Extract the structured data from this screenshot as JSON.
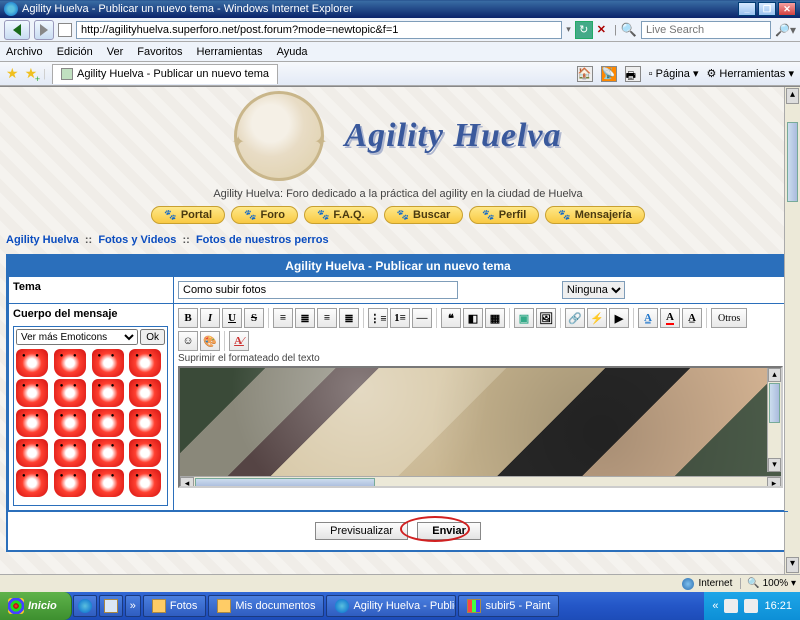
{
  "window": {
    "title": "Agility Huelva - Publicar un nuevo tema - Windows Internet Explorer"
  },
  "address_bar": {
    "url": "http://agilityhuelva.superforo.net/post.forum?mode=newtopic&f=1"
  },
  "search": {
    "placeholder": "Live Search"
  },
  "ie_menu": {
    "file": "Archivo",
    "edit": "Edición",
    "view": "Ver",
    "favorites": "Favoritos",
    "tools": "Herramientas",
    "help": "Ayuda"
  },
  "tab": {
    "label": "Agility Huelva - Publicar un nuevo tema"
  },
  "right_tools": {
    "page": "Página",
    "tools": "Herramientas"
  },
  "forum": {
    "title": "Agility Huelva",
    "subtitle": "Agility Huelva: Foro dedicado a la práctica del agility en la ciudad de Huelva",
    "nav": {
      "portal": "Portal",
      "foro": "Foro",
      "faq": "F.A.Q.",
      "buscar": "Buscar",
      "perfil": "Perfil",
      "mensajeria": "Mensajería"
    }
  },
  "breadcrumb": {
    "a": "Agility Huelva",
    "b": "Fotos y Videos",
    "c": "Fotos de nuestros perros",
    "sep": "::"
  },
  "post": {
    "header": "Agility Huelva - Publicar un nuevo tema",
    "subject_label": "Tema",
    "subject_value": "Como subir fotos",
    "subject_type": "Ninguna",
    "body_label": "Cuerpo del mensaje",
    "emoticons_select": "Ver más Emoticons",
    "emoticons_ok": "Ok",
    "toolbar": {
      "bold": "B",
      "italic": "I",
      "underline": "U",
      "strike": "S",
      "others": "Otros"
    },
    "suppress": "Suprimir el formateado del texto",
    "preview": "Previsualizar",
    "submit": "Enviar"
  },
  "statusbar": {
    "zone": "Internet",
    "zoom": "100%"
  },
  "taskbar": {
    "start": "Inicio",
    "items": {
      "fotos": "Fotos",
      "docs": "Mis documentos",
      "ie": "Agility Huelva - Public...",
      "paint": "subir5 - Paint"
    },
    "tray": {
      "lang": "«",
      "clock": "16:21"
    }
  }
}
